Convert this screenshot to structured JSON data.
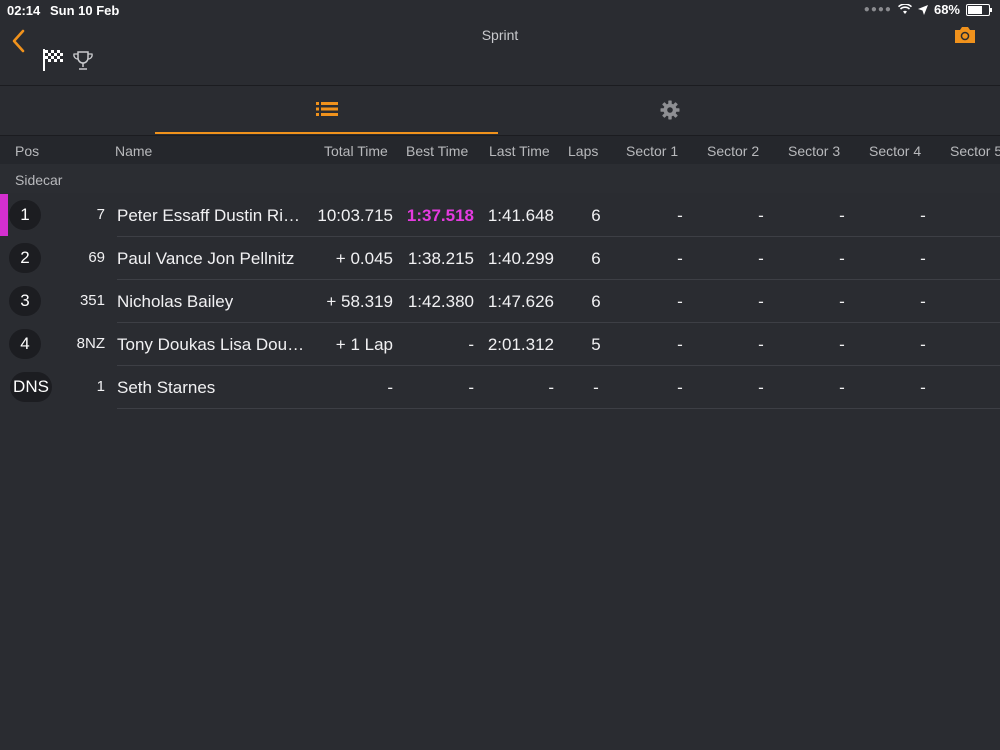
{
  "status": {
    "time": "02:14",
    "date": "Sun 10 Feb",
    "battery": "68%",
    "battery_level": 0.68
  },
  "nav": {
    "title": "Sprint",
    "icons": [
      "back-chevron-icon",
      "checkered-flag-icon",
      "trophy-icon",
      "camera-icon"
    ]
  },
  "tabs": [
    "list-icon",
    "gear-icon"
  ],
  "columns": {
    "pos": "Pos",
    "name": "Name",
    "total": "Total Time",
    "best": "Best Time",
    "last": "Last Time",
    "laps": "Laps",
    "s1": "Sector 1",
    "s2": "Sector 2",
    "s3": "Sector 3",
    "s4": "Sector 4",
    "s5": "Sector 5"
  },
  "group": "Sidecar",
  "rows": [
    {
      "pos": "1",
      "num": "7",
      "name": "Peter Essaff Dustin Ri…",
      "total": "10:03.715",
      "best": "1:37.518",
      "last": "1:41.648",
      "laps": "6",
      "s1": "-",
      "s2": "-",
      "s3": "-",
      "s4": "-"
    },
    {
      "pos": "2",
      "num": "69",
      "name": "Paul Vance Jon Pellnitz",
      "total": "+ 0.045",
      "best": "1:38.215",
      "last": "1:40.299",
      "laps": "6",
      "s1": "-",
      "s2": "-",
      "s3": "-",
      "s4": "-"
    },
    {
      "pos": "3",
      "num": "351",
      "name": "Nicholas Bailey",
      "total": "+ 58.319",
      "best": "1:42.380",
      "last": "1:47.626",
      "laps": "6",
      "s1": "-",
      "s2": "-",
      "s3": "-",
      "s4": "-"
    },
    {
      "pos": "4",
      "num": "8NZ",
      "name": "Tony Doukas Lisa Dou…",
      "total": "+ 1 Lap",
      "best": "-",
      "last": "2:01.312",
      "laps": "5",
      "s1": "-",
      "s2": "-",
      "s3": "-",
      "s4": "-"
    },
    {
      "pos": "DNS",
      "num": "1",
      "name": "Seth Starnes",
      "total": "-",
      "best": "-",
      "last": "-",
      "laps": "-",
      "s1": "-",
      "s2": "-",
      "s3": "-",
      "s4": "-"
    }
  ],
  "colors": {
    "accent": "#f0921c",
    "leader": "#d42fcf",
    "fastest_lap": "#e53be0"
  }
}
